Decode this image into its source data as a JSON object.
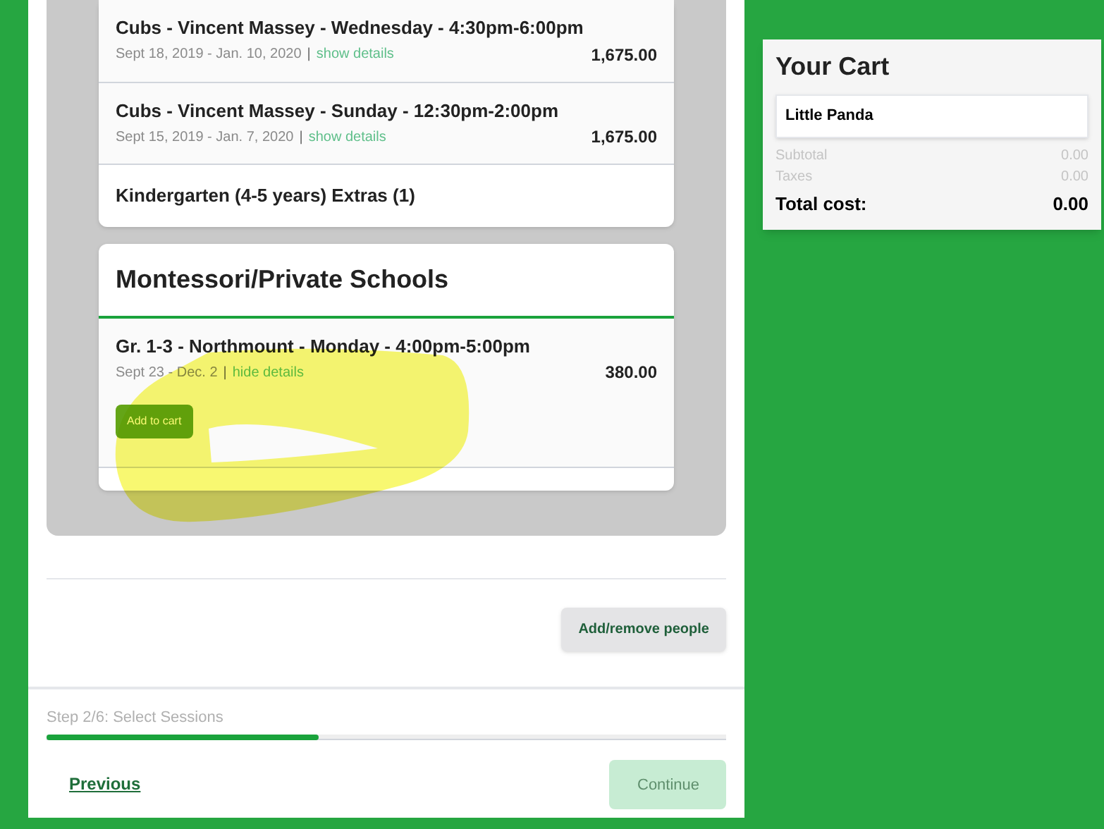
{
  "session_groups": [
    {
      "sessions": [
        {
          "name": "Cubs - Vincent Massey - Wednesday - 4:30pm-6:00pm",
          "dates": "Sept 18, 2019 - Jan. 10, 2020",
          "separator": "|",
          "details_link": "show details",
          "price": "1,675.00"
        },
        {
          "name": "Cubs - Vincent Massey - Sunday - 12:30pm-2:00pm",
          "dates": "Sept 15, 2019 - Jan. 7, 2020",
          "separator": "|",
          "details_link": "show details",
          "price": "1,675.00"
        }
      ],
      "footer_group": "Kindergarten (4-5 years) Extras (1)"
    },
    {
      "title": "Montessori/Private Schools",
      "sessions": [
        {
          "name": "Gr. 1-3 - Northmount - Monday - 4:00pm-5:00pm",
          "dates": "Sept 23 - Dec. 2",
          "separator": "|",
          "details_link": "hide details",
          "price": "380.00",
          "button": "Add to cart"
        }
      ]
    }
  ],
  "add_remove_button": "Add/remove people",
  "progress": {
    "label": "Step 2/6: Select Sessions",
    "level": 0.4
  },
  "previous_link": "Previous",
  "continue_button": {
    "label": "Continue",
    "disabled": true
  },
  "cart": {
    "title": "Your Cart",
    "person": "Little Panda",
    "lines": [
      {
        "label": "Subtotal",
        "value": "0.00"
      },
      {
        "label": "Taxes",
        "value": "0.00"
      }
    ],
    "total_label": "Total cost:",
    "total_value": "0.00"
  }
}
